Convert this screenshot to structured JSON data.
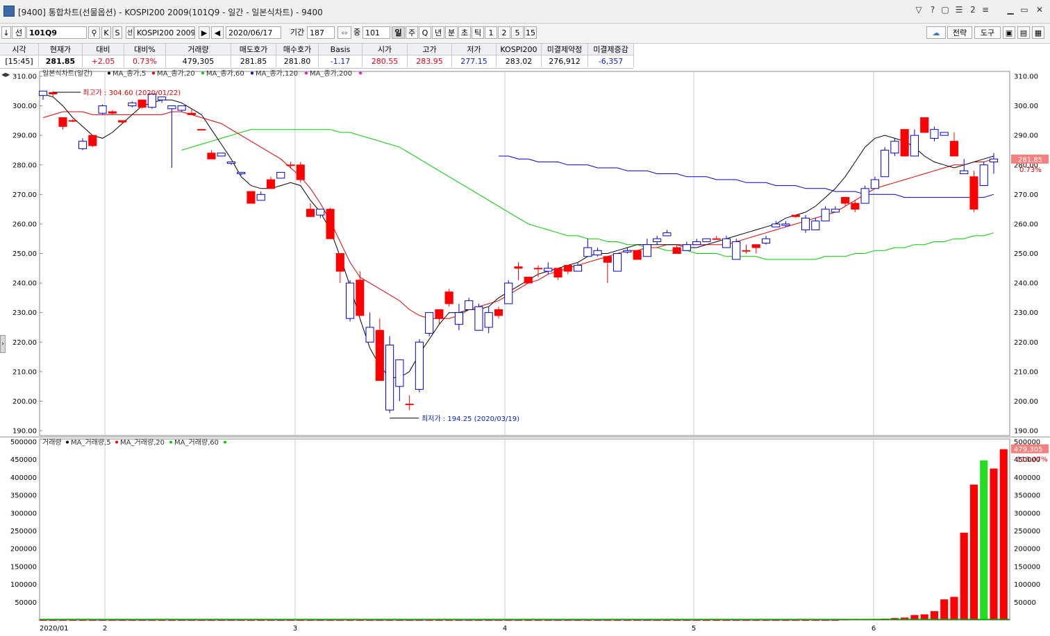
{
  "window": {
    "title": "[9400] 통합차트(선물옵션) - KOSPI200 2009(101Q9 - 일간 - 일본식차트) - 9400"
  },
  "toolbar": {
    "down_arrow": "↓",
    "seon": "선",
    "code": "101Q9",
    "k_btn": "K",
    "s_btn": "S",
    "seon_badge": "선",
    "product": "KOSPI200 2009",
    "date": "2020/06/17",
    "period_label": "기간",
    "period_value": "187",
    "jung_label": "중",
    "jung_value": "101",
    "periods": [
      "일",
      "주",
      "Q",
      "년",
      "분",
      "초",
      "틱",
      "1",
      "2",
      "5",
      "15"
    ],
    "selected_period": "일",
    "strategy": "전략",
    "tools": "도구"
  },
  "quote": {
    "headers": [
      "시각",
      "현재가",
      "대비",
      "대비%",
      "거래량",
      "매도호가",
      "매수호가",
      "Basis",
      "시가",
      "고가",
      "저가",
      "KOSPI200",
      "미결제약정",
      "미결제증감"
    ],
    "values": [
      "[15:45]",
      "281.85",
      "+2.05",
      "0.73%",
      "479,305",
      "281.85",
      "281.80",
      "-1.17",
      "280.55",
      "283.95",
      "277.15",
      "283.02",
      "276,912",
      "-6,357"
    ]
  },
  "price_panel": {
    "legend_title": "일본식차트(일간)",
    "legend": [
      {
        "name": "MA_종가,5",
        "color": "#000000"
      },
      {
        "name": "MA_종가,20",
        "color": "#e00000"
      },
      {
        "name": "MA_종가,60",
        "color": "#00cc00"
      },
      {
        "name": "MA_종가,120",
        "color": "#0000cc"
      },
      {
        "name": "MA_종가,200",
        "color": "#ff00ff"
      }
    ],
    "high_annotation": "최고가 : 304.60 (2020/01/22)",
    "low_annotation": "최저가 : 194.25 (2020/03/19)",
    "current_price_label": "281.85",
    "current_change_label": "0.73%"
  },
  "volume_panel": {
    "legend_title": "거래량",
    "legend": [
      {
        "name": "MA_거래량,5",
        "color": "#000000"
      },
      {
        "name": "MA_거래량,20",
        "color": "#e00000"
      },
      {
        "name": "MA_거래량,60",
        "color": "#00cc00"
      }
    ],
    "current_volume_label": "479,305",
    "current_ratio_label": "113.07%"
  },
  "x_axis_labels": [
    "2020/01",
    "2",
    "3",
    "4",
    "5",
    "6"
  ],
  "colors": {
    "up": "#ff0000",
    "down": "#0000cc",
    "ma5": "#000000",
    "ma20": "#e00000",
    "ma60": "#00cc00",
    "ma120": "#0000cc"
  },
  "chart_data": {
    "type": "candlestick",
    "price_axis": {
      "min": 190,
      "max": 310,
      "step": 10
    },
    "volume_axis": {
      "min": 0,
      "max": 500000,
      "step": 50000
    },
    "candles": [
      {
        "o": 305,
        "h": 305,
        "l": 302,
        "c": 303.5
      },
      {
        "o": 304,
        "h": 305,
        "l": 303,
        "c": 304.5
      },
      {
        "o": 293,
        "h": 296,
        "l": 292,
        "c": 296
      },
      {
        "o": 295,
        "h": 295.5,
        "l": 294.5,
        "c": 295
      },
      {
        "o": 288,
        "h": 289,
        "l": 285,
        "c": 285.5
      },
      {
        "o": 286.5,
        "h": 290,
        "l": 286,
        "c": 290
      },
      {
        "o": 300,
        "h": 300.5,
        "l": 297,
        "c": 297.5
      },
      {
        "o": 297.5,
        "h": 298.5,
        "l": 297,
        "c": 298
      },
      {
        "o": 294.5,
        "h": 295,
        "l": 294,
        "c": 295
      },
      {
        "o": 301,
        "h": 301.5,
        "l": 299.5,
        "c": 300
      },
      {
        "o": 299.5,
        "h": 302,
        "l": 299,
        "c": 302
      },
      {
        "o": 304,
        "h": 304,
        "l": 299,
        "c": 299.5
      },
      {
        "o": 303,
        "h": 303,
        "l": 301,
        "c": 302
      },
      {
        "o": 300,
        "h": 300,
        "l": 279,
        "c": 299
      },
      {
        "o": 300,
        "h": 300,
        "l": 298,
        "c": 298.5
      },
      {
        "o": 297,
        "h": 299,
        "l": 297,
        "c": 297.5
      },
      {
        "o": 292,
        "h": 292,
        "l": 292,
        "c": 292
      },
      {
        "o": 282,
        "h": 285,
        "l": 282,
        "c": 284
      },
      {
        "o": 284,
        "h": 284,
        "l": 283,
        "c": 283
      },
      {
        "o": 281,
        "h": 281,
        "l": 280,
        "c": 280.5
      },
      {
        "o": 277.5,
        "h": 277.5,
        "l": 276.5,
        "c": 277
      },
      {
        "o": 267,
        "h": 271,
        "l": 267,
        "c": 271
      },
      {
        "o": 270,
        "h": 271,
        "l": 268,
        "c": 268
      },
      {
        "o": 272,
        "h": 276,
        "l": 272,
        "c": 275
      },
      {
        "o": 277.5,
        "h": 277.5,
        "l": 275.5,
        "c": 275.5
      },
      {
        "o": 280,
        "h": 281,
        "l": 279,
        "c": 280
      },
      {
        "o": 275,
        "h": 281,
        "l": 274,
        "c": 280
      },
      {
        "o": 262.5,
        "h": 267,
        "l": 262.5,
        "c": 265
      },
      {
        "o": 265,
        "h": 265,
        "l": 262,
        "c": 263
      },
      {
        "o": 255,
        "h": 265.5,
        "l": 255,
        "c": 265
      },
      {
        "o": 244,
        "h": 250,
        "l": 240,
        "c": 250
      },
      {
        "o": 240,
        "h": 241,
        "l": 227,
        "c": 228
      },
      {
        "o": 229,
        "h": 244,
        "l": 229,
        "c": 241
      },
      {
        "o": 225,
        "h": 230,
        "l": 220,
        "c": 220
      },
      {
        "o": 207,
        "h": 228,
        "l": 207,
        "c": 224
      },
      {
        "o": 219,
        "h": 222,
        "l": 196,
        "c": 197
      },
      {
        "o": 214,
        "h": 214,
        "l": 200,
        "c": 205
      },
      {
        "o": 199,
        "h": 202,
        "l": 197,
        "c": 199
      },
      {
        "o": 220,
        "h": 221,
        "l": 203,
        "c": 204
      },
      {
        "o": 230,
        "h": 230,
        "l": 222,
        "c": 223
      },
      {
        "o": 228,
        "h": 231,
        "l": 226,
        "c": 231
      },
      {
        "o": 233,
        "h": 238,
        "l": 232,
        "c": 237
      },
      {
        "o": 230,
        "h": 233,
        "l": 224,
        "c": 226
      },
      {
        "o": 234,
        "h": 235,
        "l": 231,
        "c": 231
      },
      {
        "o": 232,
        "h": 233,
        "l": 224,
        "c": 224
      },
      {
        "o": 230,
        "h": 232,
        "l": 223,
        "c": 225
      },
      {
        "o": 229,
        "h": 232,
        "l": 228,
        "c": 231
      },
      {
        "o": 240,
        "h": 241,
        "l": 233,
        "c": 233
      },
      {
        "o": 245,
        "h": 247,
        "l": 241,
        "c": 245.5
      },
      {
        "o": 240,
        "h": 242,
        "l": 240,
        "c": 242
      },
      {
        "o": 245,
        "h": 246,
        "l": 242,
        "c": 245
      },
      {
        "o": 245,
        "h": 247,
        "l": 243,
        "c": 244
      },
      {
        "o": 242,
        "h": 244,
        "l": 241,
        "c": 245
      },
      {
        "o": 244,
        "h": 246,
        "l": 243,
        "c": 246
      },
      {
        "o": 246,
        "h": 247,
        "l": 245,
        "c": 244
      },
      {
        "o": 252,
        "h": 255,
        "l": 249,
        "c": 249
      },
      {
        "o": 251,
        "h": 252,
        "l": 249,
        "c": 249.5
      },
      {
        "o": 247,
        "h": 249,
        "l": 240,
        "c": 249
      },
      {
        "o": 250,
        "h": 250,
        "l": 244,
        "c": 244
      },
      {
        "o": 251,
        "h": 252,
        "l": 250,
        "c": 250.5
      },
      {
        "o": 248,
        "h": 251,
        "l": 248,
        "c": 251
      },
      {
        "o": 253,
        "h": 255,
        "l": 249,
        "c": 249
      },
      {
        "o": 255,
        "h": 256,
        "l": 253,
        "c": 254
      },
      {
        "o": 257,
        "h": 258,
        "l": 256,
        "c": 256
      },
      {
        "o": 250,
        "h": 253,
        "l": 250,
        "c": 252
      },
      {
        "o": 253,
        "h": 254,
        "l": 251,
        "c": 251
      },
      {
        "o": 254,
        "h": 255,
        "l": 253,
        "c": 253
      },
      {
        "o": 255,
        "h": 255,
        "l": 254,
        "c": 254
      },
      {
        "o": 255,
        "h": 256,
        "l": 255,
        "c": 255
      },
      {
        "o": 255,
        "h": 256,
        "l": 252,
        "c": 252
      },
      {
        "o": 254,
        "h": 255,
        "l": 248,
        "c": 248
      },
      {
        "o": 251,
        "h": 253,
        "l": 250,
        "c": 251
      },
      {
        "o": 252,
        "h": 253,
        "l": 250,
        "c": 253
      },
      {
        "o": 255,
        "h": 256,
        "l": 253,
        "c": 253.5
      },
      {
        "o": 260,
        "h": 261,
        "l": 259,
        "c": 259
      },
      {
        "o": 260,
        "h": 261,
        "l": 259,
        "c": 259.5
      },
      {
        "o": 262.5,
        "h": 263,
        "l": 262,
        "c": 263
      },
      {
        "o": 262,
        "h": 263,
        "l": 257,
        "c": 258
      },
      {
        "o": 261,
        "h": 262,
        "l": 258,
        "c": 258
      },
      {
        "o": 265,
        "h": 266,
        "l": 261,
        "c": 261
      },
      {
        "o": 265,
        "h": 266,
        "l": 264,
        "c": 264
      },
      {
        "o": 267,
        "h": 268,
        "l": 266,
        "c": 269
      },
      {
        "o": 265,
        "h": 268,
        "l": 264,
        "c": 267
      },
      {
        "o": 272,
        "h": 273,
        "l": 267,
        "c": 267
      },
      {
        "o": 275,
        "h": 276,
        "l": 272,
        "c": 272
      },
      {
        "o": 285,
        "h": 286,
        "l": 276,
        "c": 276
      },
      {
        "o": 288,
        "h": 289,
        "l": 283,
        "c": 284
      },
      {
        "o": 283,
        "h": 292,
        "l": 283,
        "c": 292
      },
      {
        "o": 290,
        "h": 292,
        "l": 283,
        "c": 283
      },
      {
        "o": 291,
        "h": 296,
        "l": 291,
        "c": 296
      },
      {
        "o": 292,
        "h": 293,
        "l": 288,
        "c": 289
      },
      {
        "o": 291,
        "h": 291,
        "l": 290,
        "c": 290
      },
      {
        "o": 283,
        "h": 291,
        "l": 283,
        "c": 288
      },
      {
        "o": 278,
        "h": 282,
        "l": 277,
        "c": 277
      },
      {
        "o": 265,
        "h": 278,
        "l": 264,
        "c": 276
      },
      {
        "o": 280,
        "h": 281,
        "l": 273,
        "c": 273
      },
      {
        "o": 282,
        "h": 284,
        "l": 277,
        "c": 281
      }
    ],
    "volumes": [
      0,
      0,
      0,
      0,
      0,
      0,
      0,
      0,
      0,
      0,
      0,
      0,
      0,
      0,
      0,
      0,
      0,
      0,
      0,
      0,
      0,
      0,
      0,
      0,
      0,
      0,
      0,
      0,
      0,
      0,
      0,
      0,
      0,
      0,
      0,
      0,
      0,
      0,
      0,
      0,
      0,
      0,
      0,
      0,
      0,
      0,
      0,
      0,
      0,
      0,
      0,
      0,
      0,
      0,
      0,
      0,
      0,
      0,
      0,
      0,
      0,
      0,
      0,
      0,
      0,
      0,
      0,
      0,
      0,
      0,
      0,
      0,
      0,
      0,
      0,
      0,
      0,
      0,
      0,
      0,
      0,
      1500,
      2000,
      2500,
      3000,
      4000,
      5500,
      7000,
      14000,
      16000,
      25000,
      58000,
      65000,
      245000,
      380000,
      448000,
      425000,
      479305
    ],
    "ma5": [
      304,
      303,
      300,
      296,
      293,
      290,
      289,
      291,
      294,
      297,
      300,
      301,
      302,
      302,
      301,
      299,
      297,
      292,
      287,
      282,
      276,
      273,
      272,
      272,
      273,
      274,
      273,
      268,
      264,
      258,
      249,
      239,
      228,
      218,
      212,
      208,
      208,
      210,
      216,
      221,
      226,
      230,
      230,
      231,
      231,
      232,
      235,
      237,
      239,
      241,
      243,
      244,
      245,
      246,
      247,
      249,
      250,
      250,
      251,
      252,
      253,
      253,
      253,
      253,
      253,
      252,
      252,
      253,
      254,
      255,
      256,
      257,
      258,
      259,
      260,
      262,
      263,
      264,
      266,
      269,
      272,
      276,
      281,
      286,
      289,
      290,
      289,
      288,
      286,
      283,
      281,
      280,
      279,
      280,
      281,
      282,
      283
    ],
    "ma20": [
      296,
      297,
      298,
      298,
      298,
      297,
      297,
      297,
      297,
      297,
      297,
      297,
      297,
      298,
      298,
      297,
      296,
      295,
      294,
      292,
      290,
      288,
      286,
      284,
      282,
      279,
      276,
      272,
      267,
      261,
      254,
      247,
      242,
      240,
      238,
      236,
      234,
      231,
      229,
      228,
      228,
      228,
      229,
      231,
      232,
      233,
      234,
      236,
      238,
      240,
      241,
      243,
      244,
      245,
      246,
      247,
      248,
      249,
      250,
      251,
      251,
      252,
      252,
      253,
      253,
      253,
      253,
      253,
      253,
      253,
      254,
      255,
      256,
      257,
      258,
      259,
      260,
      261,
      262,
      263,
      264,
      266,
      268,
      270,
      272,
      273,
      274,
      275,
      276,
      277,
      278,
      279,
      280,
      280,
      281,
      281,
      282
    ],
    "ma60": [
      285,
      286,
      287,
      288,
      289,
      290,
      291,
      292,
      292,
      292,
      292,
      292,
      292,
      292,
      292,
      292,
      291,
      291,
      290,
      289,
      288,
      287,
      286,
      284,
      282,
      280,
      278,
      276,
      274,
      272,
      270,
      268,
      266,
      264,
      262,
      260,
      259,
      258,
      257,
      256,
      256,
      255,
      255,
      254,
      254,
      253,
      253,
      252,
      252,
      251,
      251,
      251,
      250,
      250,
      250,
      249,
      249,
      249,
      249,
      248,
      248,
      248,
      248,
      248,
      248,
      249,
      249,
      249,
      250,
      250,
      251,
      251,
      252,
      252,
      253,
      253,
      254,
      254,
      255,
      255,
      256,
      256,
      257
    ],
    "ma120": [
      283,
      283,
      282,
      282,
      281,
      281,
      281,
      280,
      280,
      280,
      279,
      279,
      279,
      278,
      278,
      278,
      277,
      277,
      277,
      276,
      276,
      276,
      275,
      275,
      275,
      274,
      274,
      274,
      273,
      273,
      273,
      272,
      272,
      272,
      271,
      271,
      271,
      270,
      270,
      270,
      270,
      269,
      269,
      269,
      269,
      269,
      269,
      269,
      269,
      269,
      270
    ]
  }
}
